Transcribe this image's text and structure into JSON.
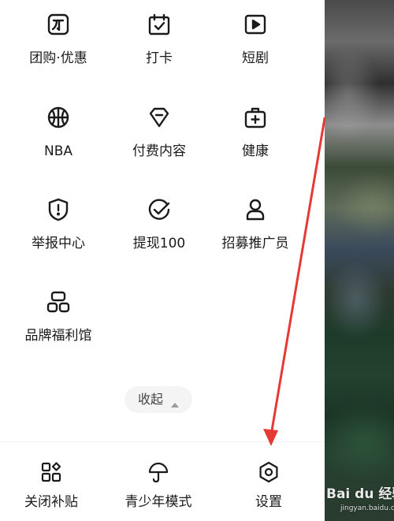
{
  "menu_grid": {
    "items": [
      {
        "label": "团购·优惠",
        "icon": "group-buy-icon"
      },
      {
        "label": "打卡",
        "icon": "calendar-check-icon"
      },
      {
        "label": "短剧",
        "icon": "play-icon"
      },
      {
        "label": "NBA",
        "icon": "basketball-icon"
      },
      {
        "label": "付费内容",
        "icon": "diamond-icon"
      },
      {
        "label": "健康",
        "icon": "medical-kit-icon"
      },
      {
        "label": "举报中心",
        "icon": "shield-alert-icon"
      },
      {
        "label": "提现100",
        "icon": "check-circle-icon"
      },
      {
        "label": "招募推广员",
        "icon": "person-icon"
      },
      {
        "label": "品牌福利馆",
        "icon": "brand-icon"
      }
    ]
  },
  "collapse": {
    "label": "收起",
    "icon": "caret-up-icon"
  },
  "bottom_bar": {
    "items": [
      {
        "label": "关闭补贴",
        "icon": "widgets-icon"
      },
      {
        "label": "青少年模式",
        "icon": "umbrella-icon"
      },
      {
        "label": "设置",
        "icon": "hexagon-settings-icon"
      }
    ]
  },
  "annotation": {
    "arrow_color": "#e53935"
  },
  "watermark": {
    "text": "Bai du 经验",
    "sub": "jingyan.baidu.com"
  }
}
